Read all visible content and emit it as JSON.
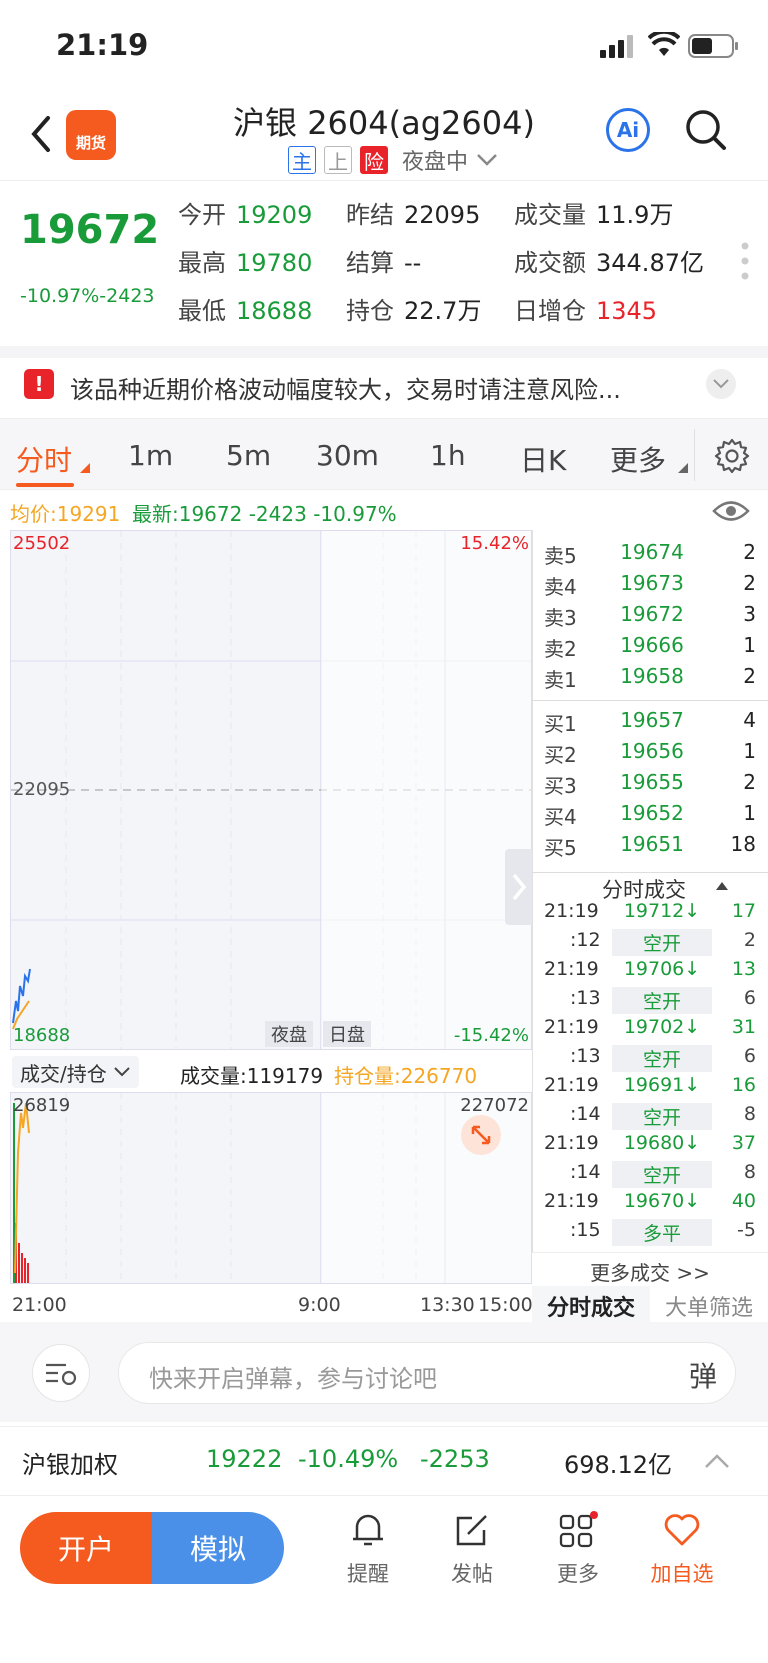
{
  "status": {
    "time": "21:19"
  },
  "header": {
    "title": "沪银 2604(ag2604)",
    "badge_main": "主",
    "badge_shang": "上",
    "badge_risk": "险",
    "session": "夜盘中",
    "logo_text": "期货",
    "ai_label": "Ai"
  },
  "quote": {
    "last": "19672",
    "change": "-10.97%-2423",
    "open_label": "今开",
    "open": "19209",
    "prev_settle_label": "昨结",
    "prev_settle": "22095",
    "volume_label": "成交量",
    "volume": "11.9万",
    "high_label": "最高",
    "high": "19780",
    "settle_label": "结算",
    "settle": "--",
    "turnover_label": "成交额",
    "turnover": "344.87亿",
    "low_label": "最低",
    "low": "18688",
    "oi_label": "持仓",
    "oi": "22.7万",
    "oi_change_label": "日增仓",
    "oi_change": "1345"
  },
  "risk": {
    "text": "该品种近期价格波动幅度较大，交易时请注意风险..."
  },
  "tabs": [
    "分时",
    "1m",
    "5m",
    "30m",
    "1h",
    "日K",
    "更多"
  ],
  "info": {
    "avg": "均价:19291",
    "latest": "最新:19672 -2423 -10.97%"
  },
  "chart": {
    "y_top": "25502",
    "y_mid": "22095",
    "y_bottom": "18688",
    "pct_top": "15.42%",
    "pct_bottom": "-15.42%",
    "session_night": "夜盘",
    "session_day": "日盘"
  },
  "volume": {
    "selector": "成交/持仓",
    "vol_text": "成交量:119179",
    "oi_text": "持仓量:226770",
    "y_left": "26819",
    "y_right": "227072"
  },
  "time_axis": {
    "t1": "21:00",
    "t2": "9:00",
    "t3": "13:30",
    "t4": "15:00"
  },
  "book": {
    "asks": [
      {
        "label": "卖5",
        "price": "19674",
        "vol": "2"
      },
      {
        "label": "卖4",
        "price": "19673",
        "vol": "2"
      },
      {
        "label": "卖3",
        "price": "19672",
        "vol": "3"
      },
      {
        "label": "卖2",
        "price": "19666",
        "vol": "1"
      },
      {
        "label": "卖1",
        "price": "19658",
        "vol": "2"
      }
    ],
    "bids": [
      {
        "label": "买1",
        "price": "19657",
        "vol": "4"
      },
      {
        "label": "买2",
        "price": "19656",
        "vol": "1"
      },
      {
        "label": "买3",
        "price": "19655",
        "vol": "2"
      },
      {
        "label": "买4",
        "price": "19652",
        "vol": "1"
      },
      {
        "label": "买5",
        "price": "19651",
        "vol": "18"
      }
    ]
  },
  "trades": {
    "title": "分时成交",
    "rows": [
      {
        "t": "21:19",
        "p": "19712↓",
        "v": "17",
        "t2": ":12",
        "p2": "空开",
        "v2": "2"
      },
      {
        "t": "21:19",
        "p": "19706↓",
        "v": "13",
        "t2": ":13",
        "p2": "空开",
        "v2": "6"
      },
      {
        "t": "21:19",
        "p": "19702↓",
        "v": "31",
        "t2": ":13",
        "p2": "空开",
        "v2": "6"
      },
      {
        "t": "21:19",
        "p": "19691↓",
        "v": "16",
        "t2": ":14",
        "p2": "空开",
        "v2": "8"
      },
      {
        "t": "21:19",
        "p": "19680↓",
        "v": "37",
        "t2": ":14",
        "p2": "空开",
        "v2": "8"
      },
      {
        "t": "21:19",
        "p": "19670↓",
        "v": "40",
        "t2": ":15",
        "p2": "多平",
        "v2": "-5"
      }
    ],
    "more": "更多成交 >>",
    "tab1": "分时成交",
    "tab2": "大单筛选"
  },
  "danmaku": {
    "placeholder": "快来开启弹幕，参与讨论吧",
    "btn": "弹"
  },
  "weighted": {
    "name": "沪银加权",
    "price": "19222",
    "pct": "-10.49%",
    "chg": "-2253",
    "amount": "698.12亿"
  },
  "bottom": {
    "open": "开户",
    "sim": "模拟",
    "alert": "提醒",
    "post": "发帖",
    "more": "更多",
    "watch": "加自选"
  },
  "colors": {
    "down": "#1a9b3a",
    "up": "#e8232a",
    "accent": "#f55a1e",
    "blue": "#4a90e8"
  }
}
